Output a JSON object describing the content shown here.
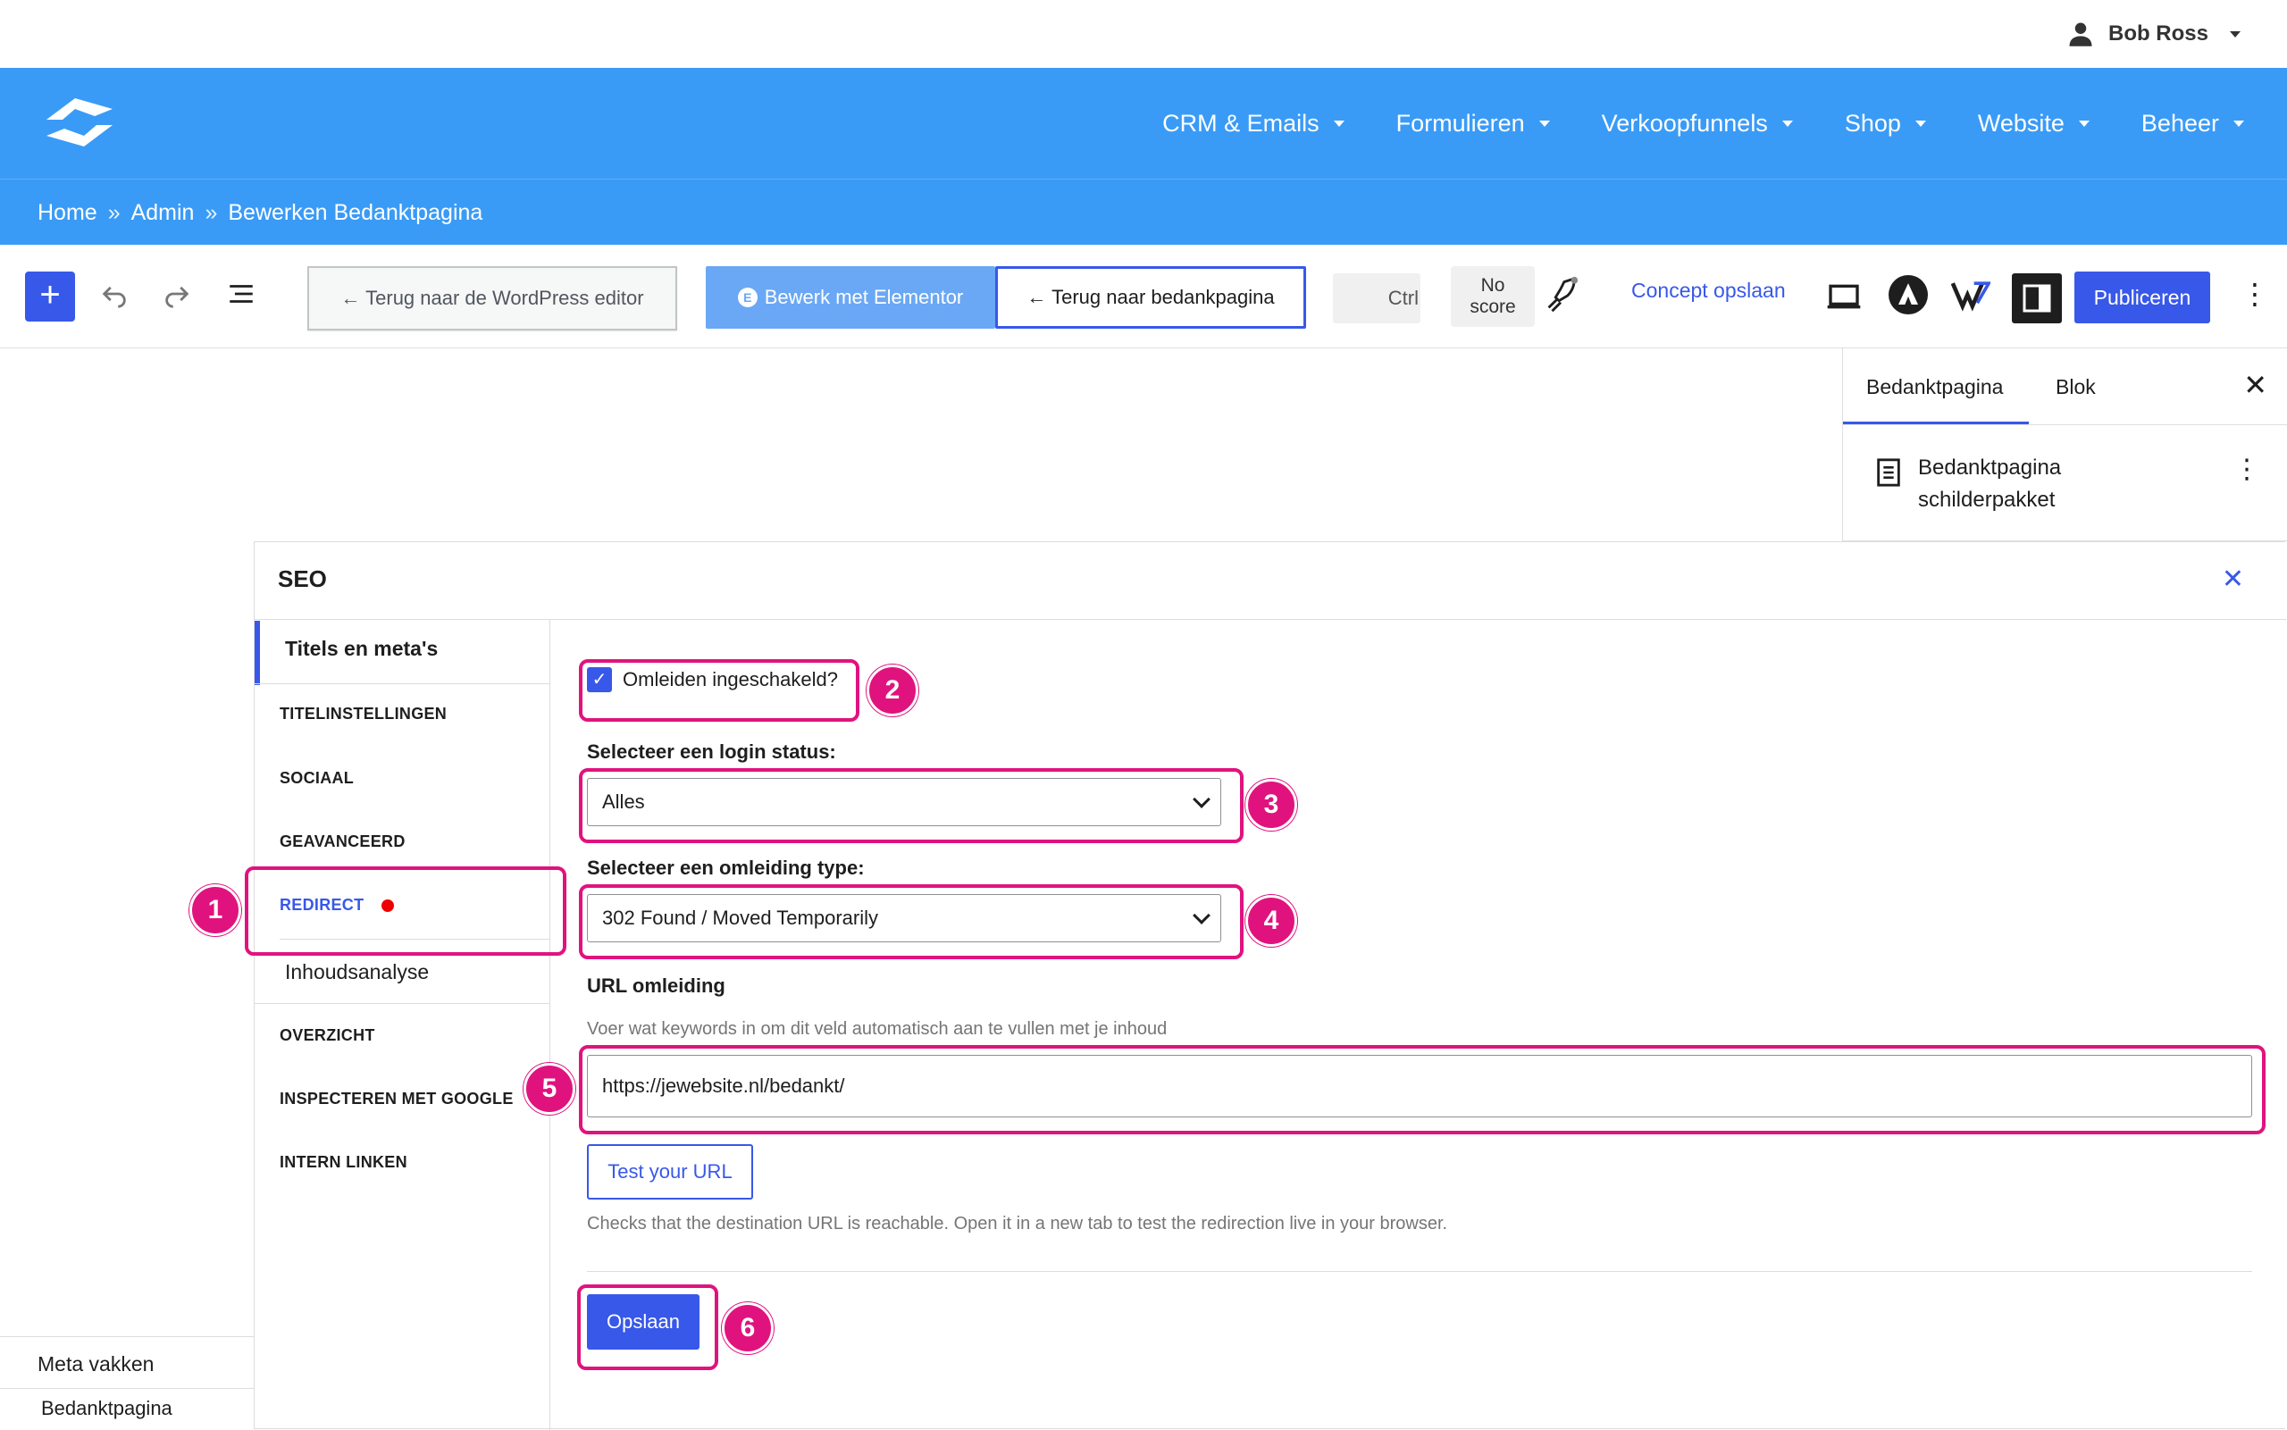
{
  "user": {
    "name": "Bob Ross"
  },
  "nav": {
    "menu": [
      {
        "label": "CRM & Emails"
      },
      {
        "label": "Formulieren"
      },
      {
        "label": "Verkoopfunnels"
      },
      {
        "label": "Shop"
      },
      {
        "label": "Website"
      },
      {
        "label": "Beheer"
      }
    ]
  },
  "breadcrumb": {
    "items": [
      "Home",
      "Admin",
      "Bewerken Bedanktpagina"
    ],
    "separator": "»"
  },
  "toolbar": {
    "wp_editor_label": "← Terug naar de WordPress editor",
    "elementor_label": "Bewerk met Elementor",
    "elementor_badge": "E",
    "back_label": "← Terug naar bedankpagina",
    "ctrl_label": "Ctrl",
    "score_line1": "No",
    "score_line2": "score",
    "concept_label": "Concept opslaan",
    "publish_label": "Publiceren",
    "accent": "#3858e9"
  },
  "sidebar": {
    "tab_page": "Bedanktpagina",
    "tab_block": "Blok",
    "doc_title": "Bedanktpagina schilderpakket"
  },
  "seo": {
    "title": "SEO",
    "nav_title": "Titels en meta's",
    "nav": [
      "TITELINSTELLINGEN",
      "SOCIAAL",
      "GEAVANCEERD",
      "REDIRECT"
    ],
    "nav_sub": "Inhoudsanalyse",
    "nav_more": [
      "OVERZICHT",
      "INSPECTEREN MET GOOGLE",
      "INTERN LINKEN"
    ],
    "redirect_enabled_label": "Omleiden ingeschakeld?",
    "redirect_enabled": true,
    "login_status_label": "Selecteer een login status:",
    "login_status_value": "Alles",
    "redirect_type_label": "Selecteer een omleiding type:",
    "redirect_type_value": "302 Found / Moved Temporarily",
    "url_label": "URL omleiding",
    "url_help": "Voer wat keywords in om dit veld automatisch aan te vullen met je inhoud",
    "url_value": "https://jewebsite.nl/bedankt/",
    "test_label": "Test your URL",
    "test_help": "Checks that the destination URL is reachable. Open it in a new tab to test the redirection live in your browser.",
    "save_label": "Opslaan"
  },
  "markers": [
    "1",
    "2",
    "3",
    "4",
    "5",
    "6"
  ],
  "highlight_color": "#e0137e",
  "meta": {
    "title": "Meta vakken",
    "sub": "Bedanktpagina"
  }
}
